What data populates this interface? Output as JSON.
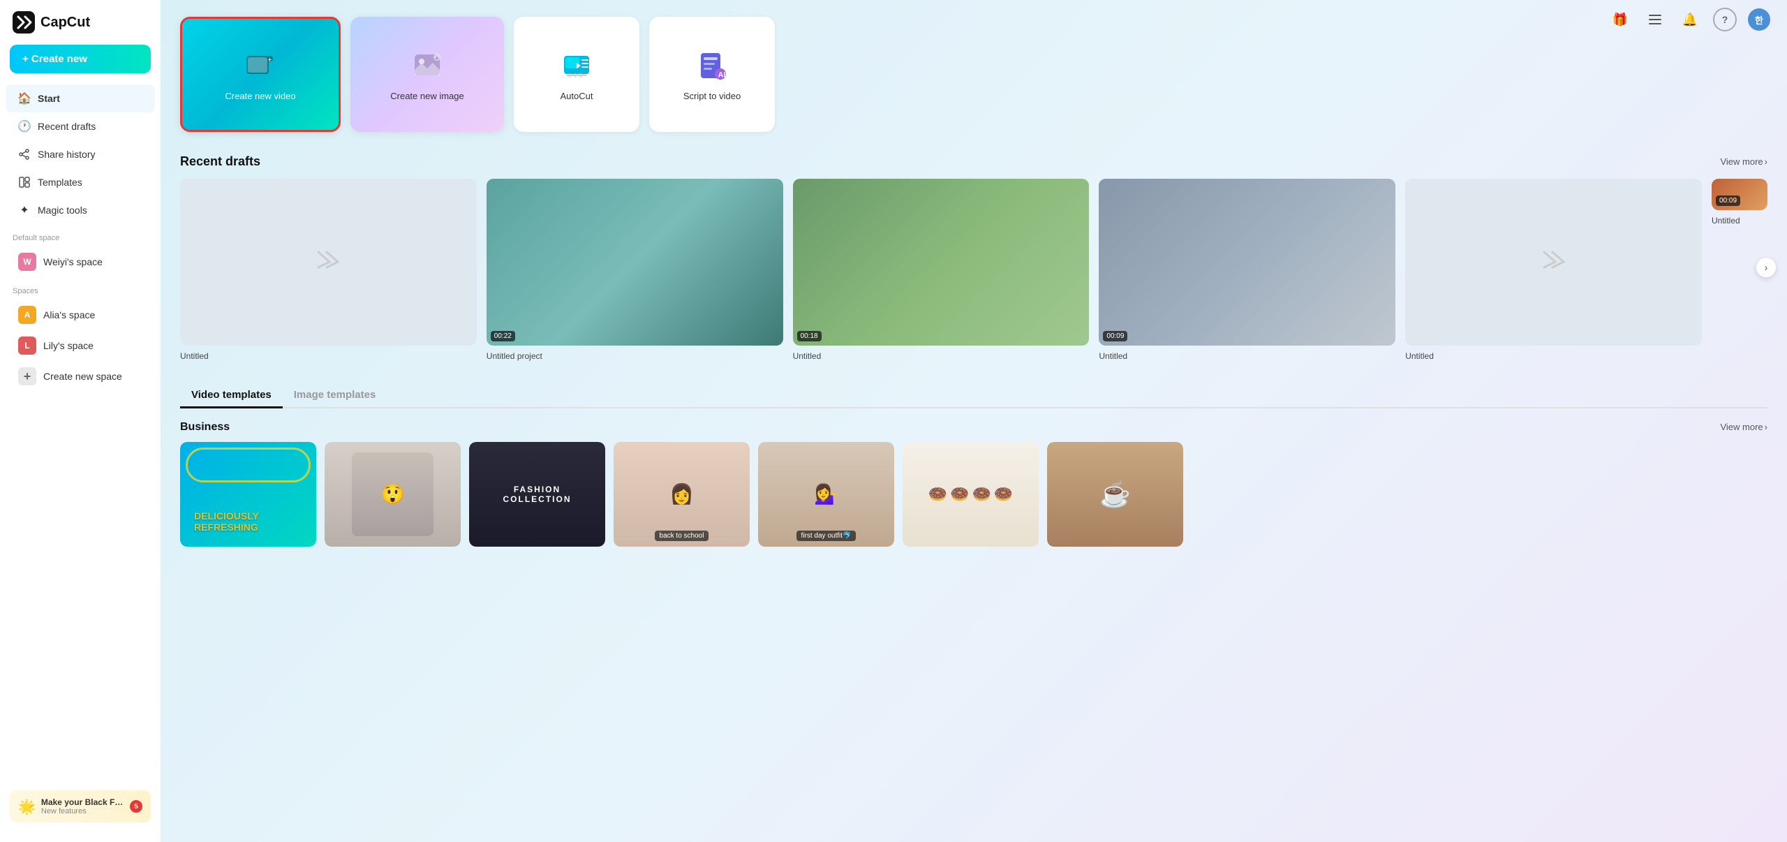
{
  "app": {
    "name": "CapCut",
    "logo_text": "CapCut"
  },
  "sidebar": {
    "create_new_label": "+ Create new",
    "nav_items": [
      {
        "id": "start",
        "label": "Start",
        "icon": "🏠",
        "active": true
      },
      {
        "id": "recent-drafts",
        "label": "Recent drafts",
        "icon": "🕐",
        "active": false
      },
      {
        "id": "share-history",
        "label": "Share history",
        "icon": "↗",
        "active": false
      },
      {
        "id": "templates",
        "label": "Templates",
        "icon": "▣",
        "active": false
      },
      {
        "id": "magic-tools",
        "label": "Magic tools",
        "icon": "✦",
        "active": false
      }
    ],
    "default_space_label": "Default space",
    "weiyi_space_label": "Weiyi's space",
    "spaces_label": "Spaces",
    "spaces": [
      {
        "id": "alia",
        "label": "Alia's space",
        "initial": "A",
        "color": "a"
      },
      {
        "id": "lily",
        "label": "Lily's space",
        "initial": "L",
        "color": "l"
      }
    ],
    "create_new_space_label": "Create new space",
    "notification": {
      "title": "Make your Black Fri...",
      "subtitle": "New features",
      "badge": "5"
    }
  },
  "topbar": {
    "avatar_text": "한",
    "gift_icon": "🎁",
    "menu_icon": "☰",
    "bell_icon": "🔔",
    "help_icon": "?"
  },
  "quick_actions": {
    "create_video": {
      "label": "Create new video",
      "selected": true
    },
    "create_image": {
      "label": "Create new image"
    },
    "autocut": {
      "label": "AutoCut"
    },
    "script_to_video": {
      "label": "Script to video"
    }
  },
  "recent_drafts": {
    "section_title": "Recent drafts",
    "view_more_label": "View more",
    "items": [
      {
        "id": 1,
        "title": "Untitled",
        "has_thumb": false,
        "duration": null
      },
      {
        "id": 2,
        "title": "Untitled project",
        "has_thumb": true,
        "thumb_class": "thumb-waterfall",
        "duration": "00:22"
      },
      {
        "id": 3,
        "title": "Untitled",
        "has_thumb": true,
        "thumb_class": "thumb-lake",
        "duration": "00:18"
      },
      {
        "id": 4,
        "title": "Untitled",
        "has_thumb": true,
        "thumb_class": "thumb-meeting",
        "duration": "00:09"
      },
      {
        "id": 5,
        "title": "Untitled",
        "has_thumb": false,
        "duration": null
      },
      {
        "id": 6,
        "title": "Untitled",
        "has_thumb": true,
        "thumb_class": "thumb-sunset",
        "duration": "00:09"
      }
    ]
  },
  "templates": {
    "tabs": [
      {
        "id": "video",
        "label": "Video templates",
        "active": true
      },
      {
        "id": "image",
        "label": "Image templates",
        "active": false
      }
    ],
    "business_section": {
      "title": "Business",
      "view_more_label": "View more",
      "items": [
        {
          "id": 1,
          "class": "tmpl-blue",
          "badge": null
        },
        {
          "id": 2,
          "class": "tmpl-gray",
          "badge": null
        },
        {
          "id": 3,
          "class": "tmpl-dark",
          "badge": null
        },
        {
          "id": 4,
          "class": "tmpl-pink",
          "badge": "back to school"
        },
        {
          "id": 5,
          "class": "tmpl-blond",
          "badge": "first day outfit🐬"
        },
        {
          "id": 6,
          "class": "tmpl-donut",
          "badge": null
        },
        {
          "id": 7,
          "class": "tmpl-coffee",
          "badge": null
        }
      ]
    }
  }
}
